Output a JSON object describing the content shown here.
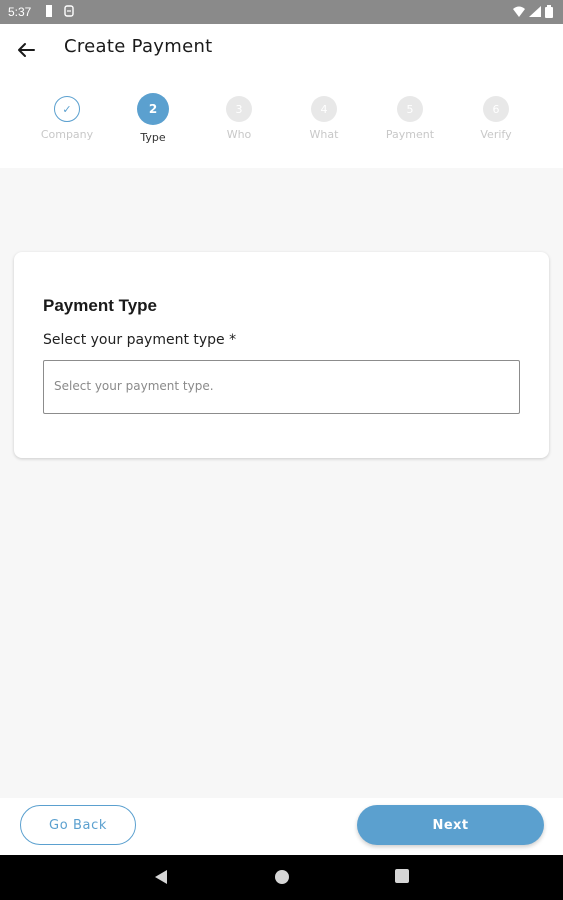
{
  "status_bar": {
    "time": "5:37",
    "left_icons": [
      "sim-icon",
      "storage-icon"
    ],
    "right_icons": [
      "wifi-icon",
      "signal-icon",
      "battery-icon"
    ]
  },
  "header": {
    "title": "Create Payment",
    "back_icon": "arrow-left-icon"
  },
  "stepper": {
    "accent_color": "#5ba0cf",
    "steps": [
      {
        "number": "✓",
        "label": "Company",
        "state": "done"
      },
      {
        "number": "2",
        "label": "Type",
        "state": "active"
      },
      {
        "number": "3",
        "label": "Who",
        "state": "pending"
      },
      {
        "number": "4",
        "label": "What",
        "state": "pending"
      },
      {
        "number": "5",
        "label": "Payment",
        "state": "pending"
      },
      {
        "number": "6",
        "label": "Verify",
        "state": "pending"
      }
    ]
  },
  "card": {
    "title": "Payment Type",
    "field_label": "Select your payment type *",
    "select_placeholder": "Select your payment type."
  },
  "footer": {
    "back_label": "Go Back",
    "next_label": "Next"
  },
  "nav_bar": {
    "icons": [
      "back-triangle-icon",
      "home-circle-icon",
      "recents-square-icon"
    ]
  }
}
